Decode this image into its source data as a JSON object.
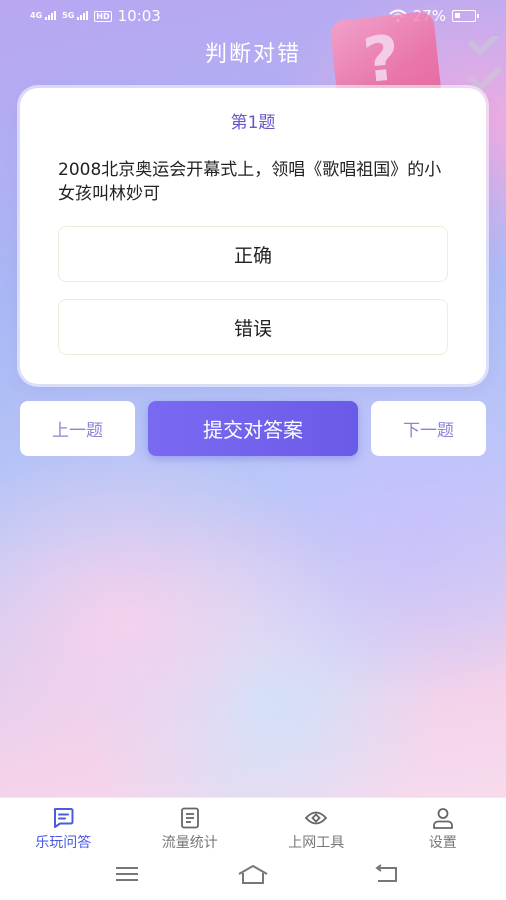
{
  "status_bar": {
    "network_1": "4G",
    "network_2": "5G",
    "hd_badge": "HD",
    "time": "10:03",
    "battery": "27%"
  },
  "page_title": "判断对错",
  "question": {
    "number_label": "第1题",
    "text": "2008北京奥运会开幕式上，领唱《歌唱祖国》的小女孩叫林妙可",
    "options": [
      {
        "label": "正确"
      },
      {
        "label": "错误"
      }
    ]
  },
  "actions": {
    "prev": "上一题",
    "submit": "提交对答案",
    "next": "下一题"
  },
  "bottom_nav": {
    "active_index": 0,
    "active_color": "#4a5be0",
    "tabs": [
      {
        "label": "乐玩问答",
        "icon": "chat-icon"
      },
      {
        "label": "流量统计",
        "icon": "document-icon"
      },
      {
        "label": "上网工具",
        "icon": "eye-icon"
      },
      {
        "label": "设置",
        "icon": "person-icon"
      }
    ]
  },
  "accent_color": "#6a5ae8"
}
